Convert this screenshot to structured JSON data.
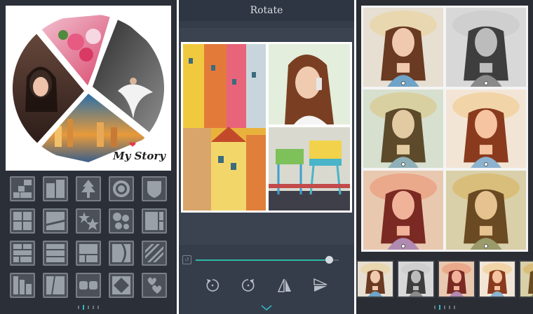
{
  "panel_collage": {
    "caption": "My Story",
    "template_icons": [
      "stair-grid-template-icon",
      "two-column-template-icon",
      "tree-template-icon",
      "target-circle-template-icon",
      "shield-template-icon",
      "four-square-template-icon",
      "diagonal-split-template-icon",
      "stars-template-icon",
      "bubbles-template-icon",
      "column-split-template-icon",
      "brick-grid-template-icon",
      "three-row-template-icon",
      "mosaic-template-icon",
      "curve-split-template-icon",
      "striped-template-icon",
      "bars-template-icon",
      "trapezoid-template-icon",
      "pill-template-icon",
      "diamond-template-icon",
      "hearts-template-icon"
    ],
    "page_count": 5,
    "active_page": 2
  },
  "panel_rotate": {
    "title": "Rotate",
    "slider_value": 0.93,
    "tools": [
      "rotate-left-icon",
      "rotate-right-icon",
      "flip-horizontal-icon",
      "flip-vertical-icon"
    ]
  },
  "panel_filters": {
    "filter_count": 6,
    "thumb_count": 5,
    "page_count": 5,
    "active_page": 2
  },
  "colors": {
    "accent": "#2fb8c8",
    "dark_bg": "#2b2f37",
    "panel_bg": "#353d4a"
  }
}
